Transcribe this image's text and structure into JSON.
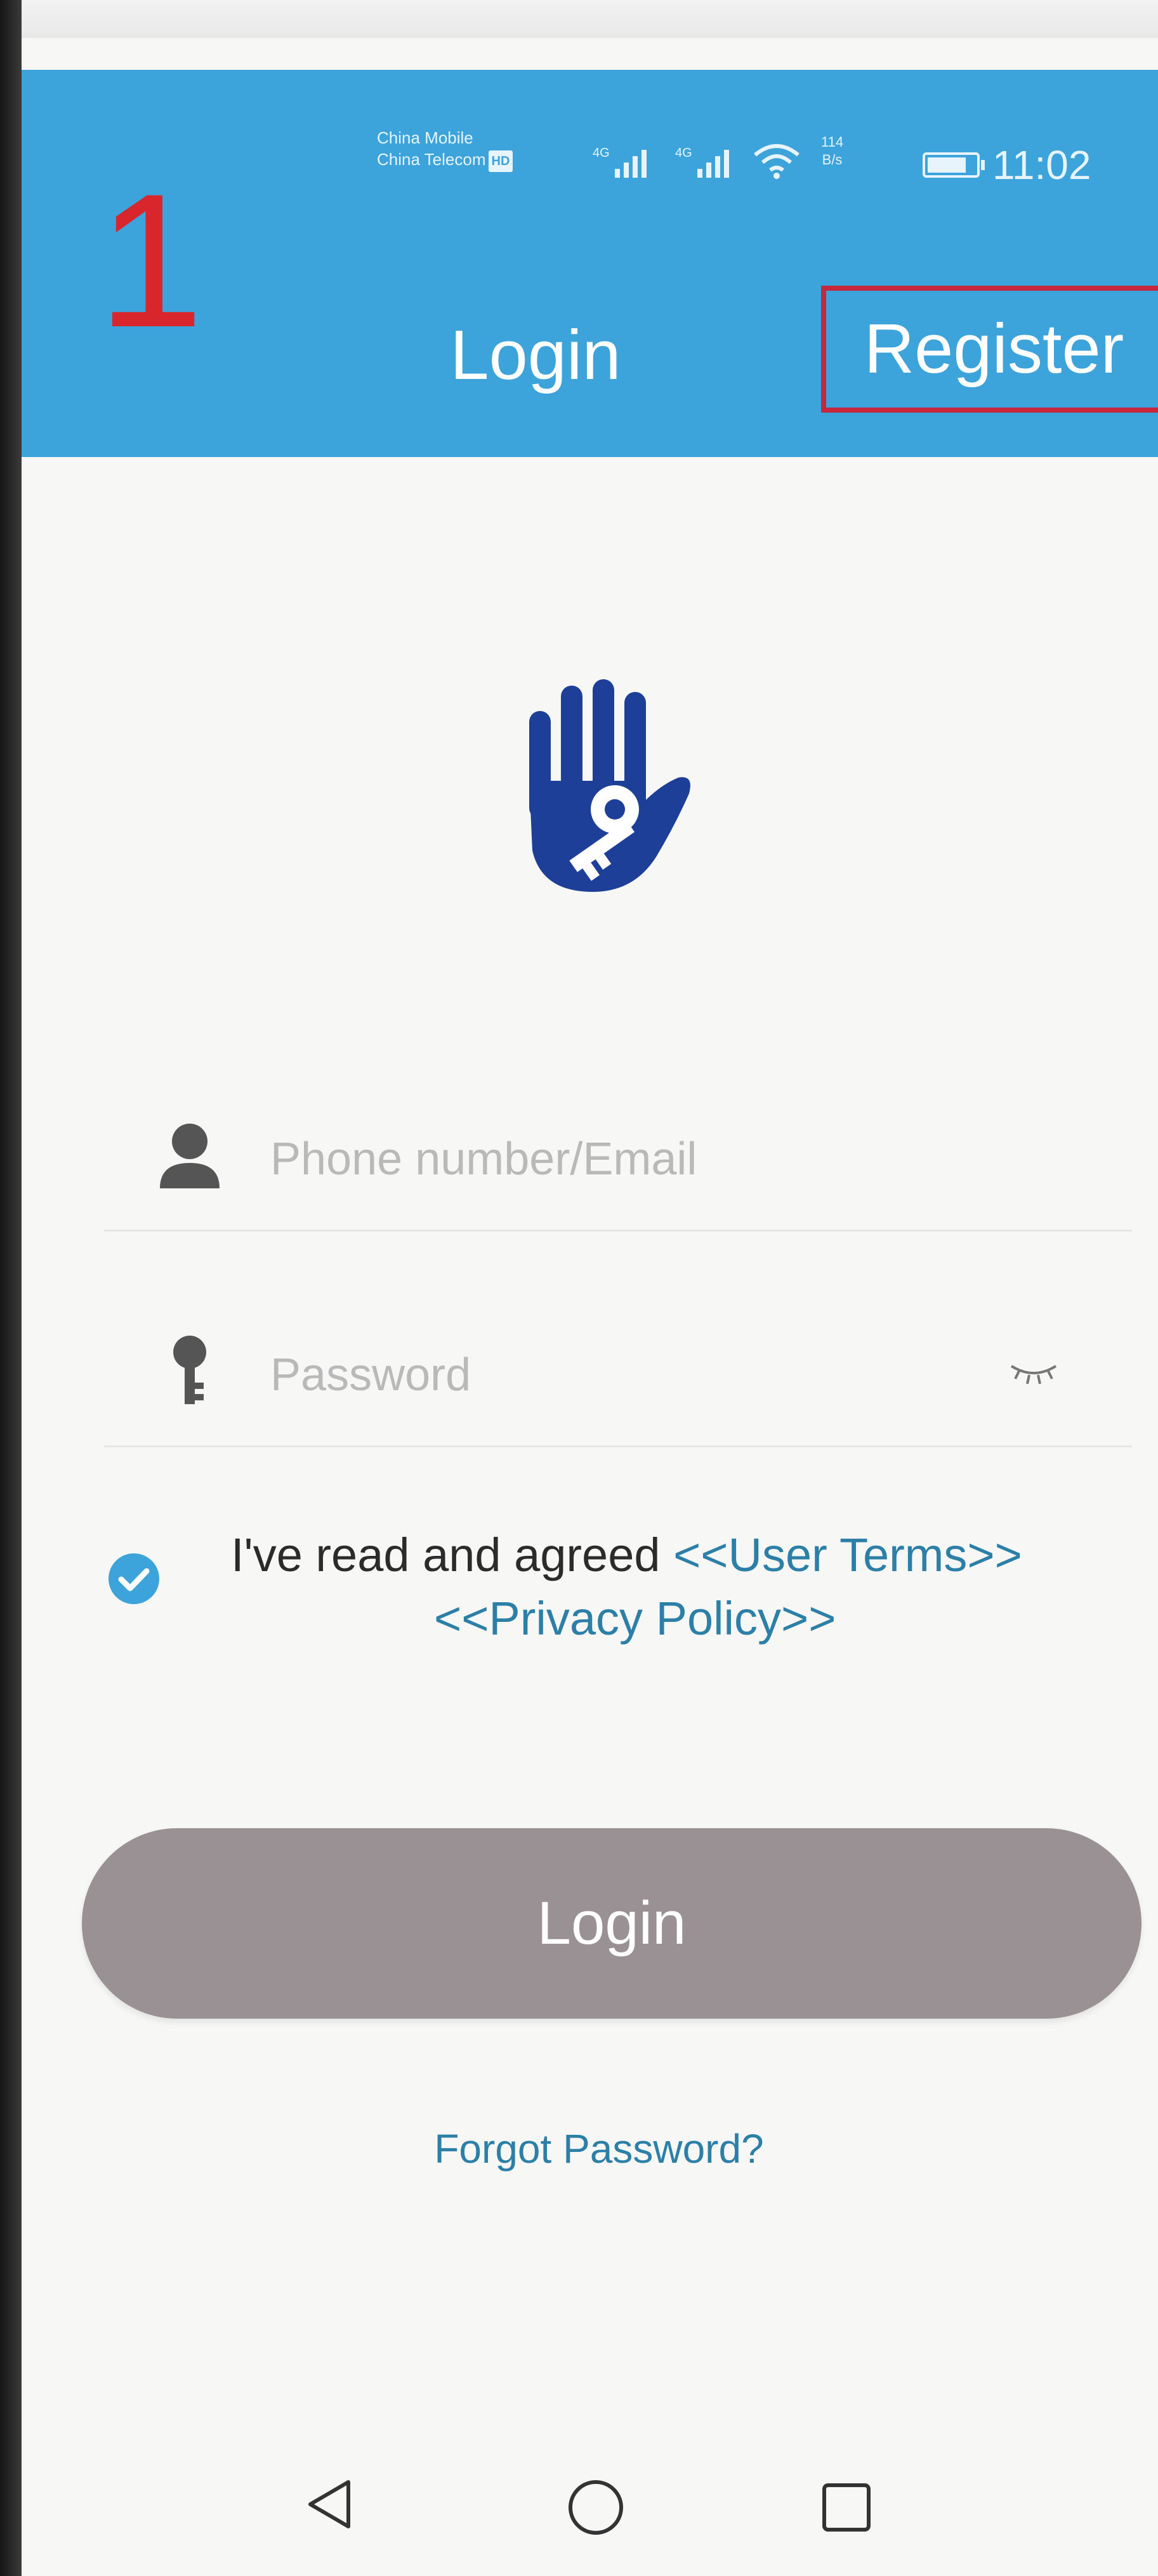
{
  "step_number": "1",
  "status_bar": {
    "carrier_1": "China Mobile",
    "carrier_2": "China Telecom",
    "hd_badge": "HD",
    "network_1": "4G",
    "network_2": "4G",
    "speed_value": "114",
    "speed_unit": "B/s",
    "time": "11:02"
  },
  "header": {
    "title": "Login",
    "register_label": "Register"
  },
  "form": {
    "phone_placeholder": "Phone number/Email",
    "phone_value": "",
    "password_placeholder": "Password",
    "password_value": ""
  },
  "agreement": {
    "checked": true,
    "text": "I've read and agreed ",
    "user_terms_link": "<<User Terms>>",
    "privacy_policy_link": "<<Privacy Policy>>"
  },
  "login_button_label": "Login",
  "forgot_password_label": "Forgot Password?",
  "colors": {
    "header_blue": "#3ca3db",
    "logo_blue": "#1e3f97",
    "link_blue": "#2c7fa7",
    "login_button": "#999194",
    "annotation_red": "#c5283d"
  },
  "icons": {
    "logo": "hand-key-logo-icon",
    "user": "user-icon",
    "password": "key-icon",
    "eye": "eye-closed-icon",
    "check": "check-circle-icon",
    "back": "back-triangle-icon",
    "home": "home-circle-icon",
    "recents": "recents-square-icon"
  }
}
